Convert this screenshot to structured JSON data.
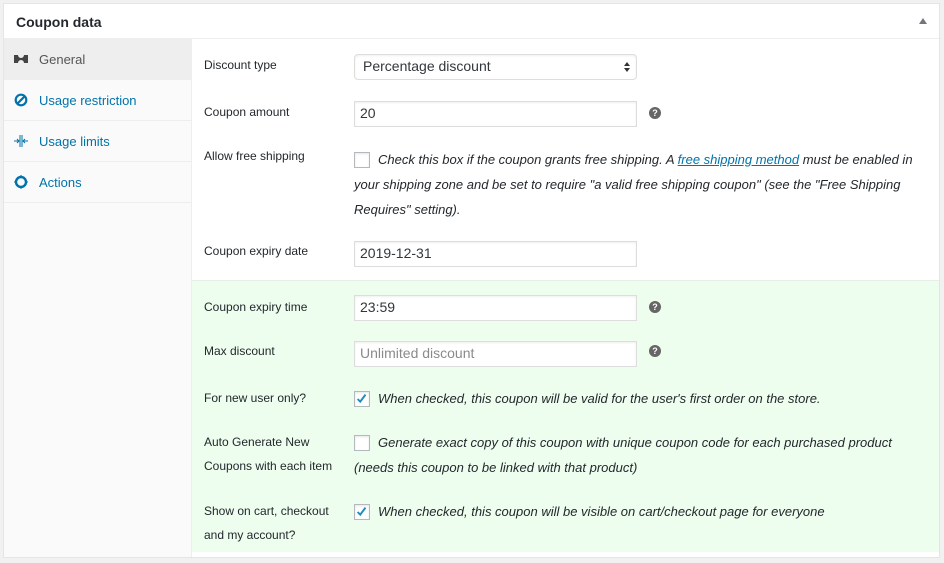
{
  "header": {
    "title": "Coupon data",
    "toggle_icon": "triangle-up-icon"
  },
  "tabs": [
    {
      "label": "General",
      "icon": "ticket-icon",
      "active": true
    },
    {
      "label": "Usage restriction",
      "icon": "block-icon",
      "active": false
    },
    {
      "label": "Usage limits",
      "icon": "limits-icon",
      "active": false
    },
    {
      "label": "Actions",
      "icon": "gear-icon",
      "active": false
    }
  ],
  "fields": {
    "discount_type": {
      "label": "Discount type",
      "value": "Percentage discount"
    },
    "coupon_amount": {
      "label": "Coupon amount",
      "value": "20"
    },
    "free_shipping": {
      "label": "Allow free shipping",
      "checked": false,
      "desc_before": "Check this box if the coupon grants free shipping. A ",
      "link": "free shipping method",
      "desc_after": " must be enabled in your shipping zone and be set to require \"a valid free shipping coupon\" (see the \"Free Shipping Requires\" setting)."
    },
    "expiry_date": {
      "label": "Coupon expiry date",
      "value": "2019-12-31"
    },
    "expiry_time": {
      "label": "Coupon expiry time",
      "value": "23:59"
    },
    "max_discount": {
      "label": "Max discount",
      "placeholder": "Unlimited discount"
    },
    "new_user": {
      "label": "For new user only?",
      "checked": true,
      "desc": "When checked, this coupon will be valid for the user's first order on the store."
    },
    "auto_generate": {
      "label_line1": "Auto Generate New",
      "label_line2": "Coupons with each item",
      "checked": false,
      "desc_line1": "Generate exact copy of this coupon with unique coupon code for each purchased product",
      "desc_line2": "(needs this coupon to be linked with that product)"
    },
    "show_on_cart": {
      "label_line1": "Show on cart, checkout",
      "label_line2": "and my account?",
      "checked": true,
      "desc": "When checked, this coupon will be visible on cart/checkout page for everyone"
    }
  },
  "help_glyph": "?",
  "colors": {
    "link": "#0073aa",
    "highlight_bg": "#edfdee",
    "checkmark": "#1e8cbe"
  }
}
